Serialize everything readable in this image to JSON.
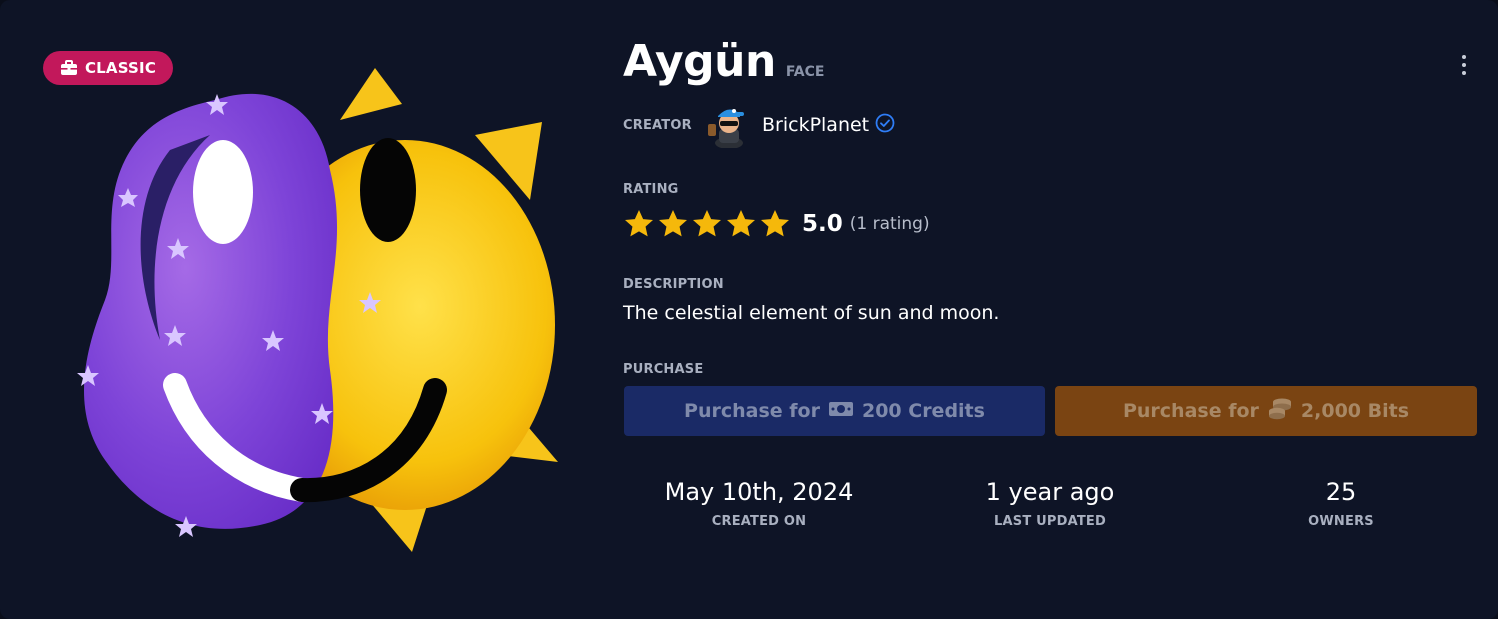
{
  "badge": {
    "label": "CLASSIC",
    "icon": "briefcase-icon",
    "color": "#c2185b"
  },
  "item": {
    "name": "Aygün",
    "type": "FACE"
  },
  "creator": {
    "label": "CREATOR",
    "name": "BrickPlanet",
    "verified": true,
    "accent": "#2f7df6"
  },
  "rating": {
    "label": "RATING",
    "stars": 5,
    "max_stars": 5,
    "value": "5.0",
    "count_text": "(1 rating)",
    "star_color": "#f5b80b"
  },
  "description": {
    "label": "DESCRIPTION",
    "text": "The celestial element of sun and moon."
  },
  "purchase": {
    "label": "PURCHASE",
    "credits": {
      "prefix": "Purchase for",
      "amount": "200 Credits",
      "icon": "banknote-icon",
      "color": "#1a2a66"
    },
    "bits": {
      "prefix": "Purchase for",
      "amount": "2,000 Bits",
      "icon": "coins-icon",
      "color": "#7a4412"
    }
  },
  "stats": [
    {
      "value": "May 10th, 2024",
      "label": "CREATED ON"
    },
    {
      "value": "1 year ago",
      "label": "LAST UPDATED"
    },
    {
      "value": "25",
      "label": "OWNERS"
    }
  ]
}
